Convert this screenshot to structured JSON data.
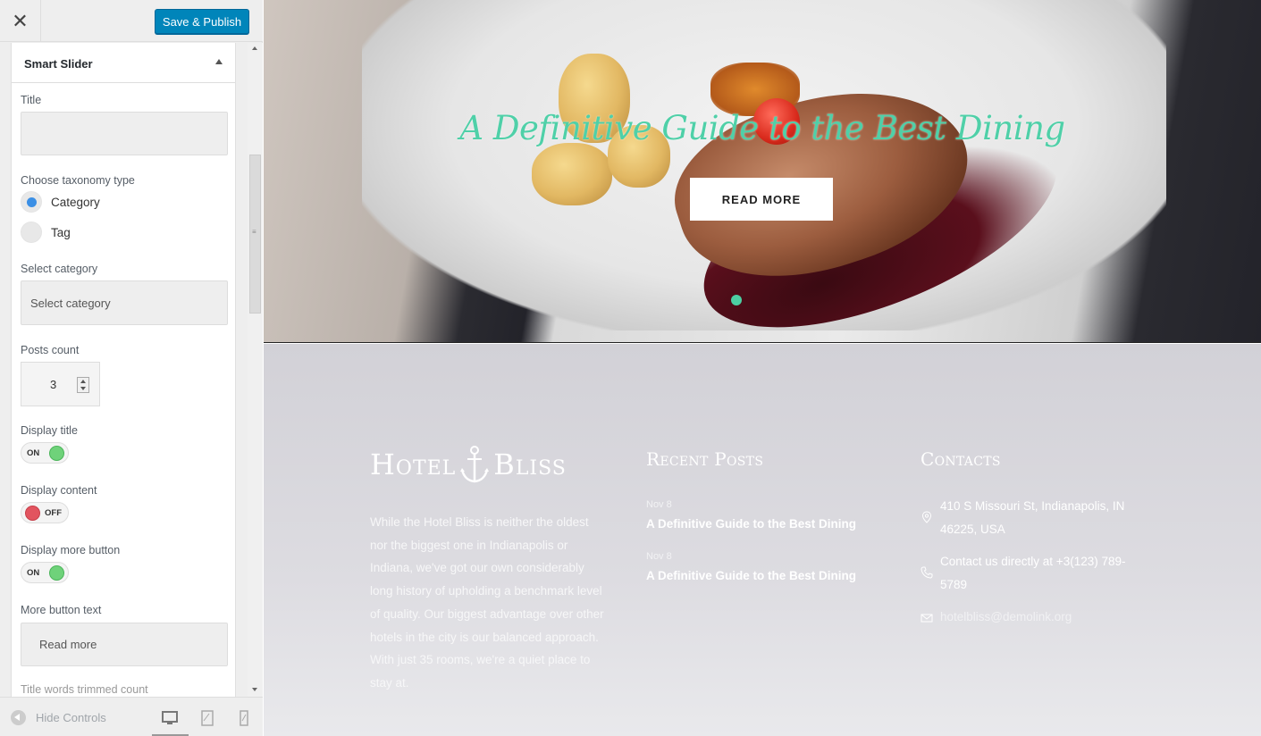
{
  "topbar": {
    "save_label": "Save & Publish"
  },
  "section": {
    "title": "Smart Slider"
  },
  "controls": {
    "title_label": "Title",
    "title_value": "",
    "taxonomy_label": "Choose taxonomy type",
    "taxonomy_options": [
      "Category",
      "Tag"
    ],
    "taxonomy_selected": "Category",
    "category_label": "Select category",
    "category_placeholder": "Select category",
    "posts_count_label": "Posts count",
    "posts_count_value": "3",
    "display_title_label": "Display title",
    "display_title_state": "ON",
    "display_content_label": "Display content",
    "display_content_state": "OFF",
    "display_more_label": "Display more button",
    "display_more_state": "ON",
    "more_text_label": "More button text",
    "more_text_value": "Read more",
    "trim_label": "Title words trimmed count"
  },
  "footer_bar": {
    "hide_controls": "Hide Controls",
    "devices": [
      "desktop-icon",
      "tablet-icon",
      "mobile-icon"
    ]
  },
  "preview": {
    "hero": {
      "title": "A Definitive Guide to the Best Dining",
      "button": "READ MORE",
      "accent_color": "#4fd0a8"
    },
    "footer": {
      "logo_left": "Hotel",
      "logo_right": "Bliss",
      "about": "While the Hotel Bliss is neither the oldest nor the biggest one in Indianapolis or Indiana, we've got our own considerably long history of upholding a benchmark level of quality. Our biggest advantage over other hotels in the city is our balanced approach. With just 35 rooms, we're a quiet place to stay at.",
      "recent_heading": "Recent Posts",
      "posts": [
        {
          "date": "Nov 8",
          "title": "A Definitive Guide to the Best Dining"
        },
        {
          "date": "Nov 8",
          "title": "A Definitive Guide to the Best Dining"
        }
      ],
      "contacts_heading": "Contacts",
      "address": "410 S Missouri St, Indianapolis, IN 46225, USA",
      "phone": "Contact us directly at +3(123) 789-5789",
      "email": "hotelbliss@demolink.org"
    }
  }
}
